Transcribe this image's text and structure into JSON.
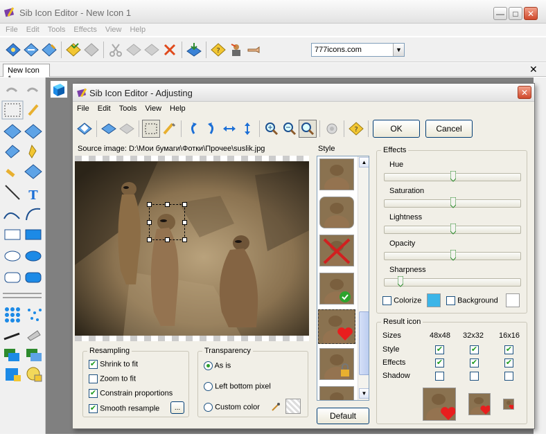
{
  "main_window": {
    "title": "Sib Icon Editor - New Icon 1",
    "menu": [
      "File",
      "Edit",
      "Tools",
      "Effects",
      "View",
      "Help"
    ],
    "url_combo_value": "777icons.com",
    "doc_tab": "New Icon 1"
  },
  "dialog": {
    "title": "Sib Icon Editor - Adjusting",
    "menu": [
      "File",
      "Edit",
      "Tools",
      "View",
      "Help"
    ],
    "ok_label": "OK",
    "cancel_label": "Cancel",
    "source_label": "Source image: D:\\Мои бумаги\\Фотки\\Прочее\\suslik.jpg",
    "style_label": "Style",
    "default_label": "Default",
    "resampling": {
      "title": "Resampling",
      "options": [
        {
          "label": "Shrink to fit",
          "checked": true
        },
        {
          "label": "Zoom to fit",
          "checked": false
        },
        {
          "label": "Constrain proportions",
          "checked": true
        },
        {
          "label": "Smooth resample",
          "checked": true
        }
      ],
      "more_label": "..."
    },
    "transparency": {
      "title": "Transparency",
      "options": [
        {
          "label": "As is",
          "selected": true
        },
        {
          "label": "Left bottom pixel",
          "selected": false
        },
        {
          "label": "Custom color",
          "selected": false
        }
      ]
    },
    "effects": {
      "title": "Effects",
      "sliders": [
        {
          "label": "Hue",
          "value": 0.5
        },
        {
          "label": "Saturation",
          "value": 0.5
        },
        {
          "label": "Lightness",
          "value": 0.5
        },
        {
          "label": "Opacity",
          "value": 0.5
        },
        {
          "label": "Sharpness",
          "value": 0.1
        }
      ],
      "colorize_label": "Colorize",
      "colorize_color": "#3cb5e8",
      "background_label": "Background",
      "background_color": "#ffffff"
    },
    "result": {
      "title": "Result icon",
      "sizes_label": "Sizes",
      "columns": [
        "48x48",
        "32x32",
        "16x16"
      ],
      "rows": [
        {
          "label": "Style",
          "values": [
            true,
            true,
            true
          ]
        },
        {
          "label": "Effects",
          "values": [
            true,
            true,
            true
          ]
        },
        {
          "label": "Shadow",
          "values": [
            false,
            false,
            false
          ]
        }
      ]
    }
  }
}
